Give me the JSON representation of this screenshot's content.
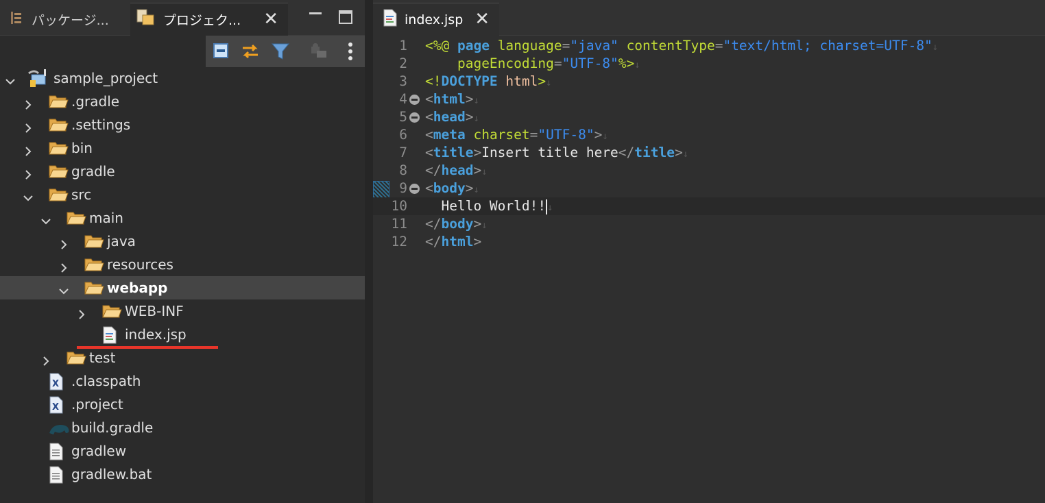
{
  "left_tabs": {
    "package_explorer": "パッケージ...",
    "project_explorer": "プロジェク..."
  },
  "tree": {
    "items": [
      {
        "label": "sample_project",
        "depth": 0,
        "expanded": true,
        "type": "project"
      },
      {
        "label": ".gradle",
        "depth": 1,
        "expanded": false,
        "type": "folder"
      },
      {
        "label": ".settings",
        "depth": 1,
        "expanded": false,
        "type": "folder"
      },
      {
        "label": "bin",
        "depth": 1,
        "expanded": false,
        "type": "folder"
      },
      {
        "label": "gradle",
        "depth": 1,
        "expanded": false,
        "type": "folder"
      },
      {
        "label": "src",
        "depth": 1,
        "expanded": true,
        "type": "folder"
      },
      {
        "label": "main",
        "depth": 2,
        "expanded": true,
        "type": "folder"
      },
      {
        "label": "java",
        "depth": 3,
        "expanded": false,
        "type": "folder"
      },
      {
        "label": "resources",
        "depth": 3,
        "expanded": false,
        "type": "folder"
      },
      {
        "label": "webapp",
        "depth": 3,
        "expanded": true,
        "type": "folder",
        "selected": true
      },
      {
        "label": "WEB-INF",
        "depth": 4,
        "expanded": false,
        "type": "folder"
      },
      {
        "label": "index.jsp",
        "depth": 4,
        "type": "jsp"
      },
      {
        "label": "test",
        "depth": 2,
        "expanded": false,
        "type": "folder"
      },
      {
        "label": ".classpath",
        "depth": 1,
        "type": "xml"
      },
      {
        "label": ".project",
        "depth": 1,
        "type": "xml"
      },
      {
        "label": "build.gradle",
        "depth": 1,
        "type": "gradle"
      },
      {
        "label": "gradlew",
        "depth": 1,
        "type": "file"
      },
      {
        "label": "gradlew.bat",
        "depth": 1,
        "type": "file"
      }
    ]
  },
  "editor": {
    "tab_label": "index.jsp",
    "current_line": 10,
    "lines": [
      {
        "n": "1",
        "fold": false,
        "tokens": [
          [
            "c-dir",
            "<%@ "
          ],
          [
            "c-kw",
            "page"
          ],
          [
            "c-text",
            " "
          ],
          [
            "c-attr",
            "language"
          ],
          [
            "c-punct",
            "="
          ],
          [
            "c-str",
            "\"java\""
          ],
          [
            "c-text",
            " "
          ],
          [
            "c-attr",
            "contentType"
          ],
          [
            "c-punct",
            "="
          ],
          [
            "c-str",
            "\"text/html; charset=UTF-8\""
          ],
          [
            "c-eol",
            "↓"
          ]
        ]
      },
      {
        "n": "2",
        "fold": false,
        "tokens": [
          [
            "c-text",
            "    "
          ],
          [
            "c-attr",
            "pageEncoding"
          ],
          [
            "c-punct",
            "="
          ],
          [
            "c-str",
            "\"UTF-8\""
          ],
          [
            "c-dir",
            "%>"
          ],
          [
            "c-eol",
            "↓"
          ]
        ]
      },
      {
        "n": "3",
        "fold": false,
        "tokens": [
          [
            "c-dir",
            "<!"
          ],
          [
            "c-kw",
            "DOCTYPE"
          ],
          [
            "c-text",
            " "
          ],
          [
            "c-doctype-name",
            "html"
          ],
          [
            "c-dir",
            ">"
          ],
          [
            "c-eol",
            "↓"
          ]
        ]
      },
      {
        "n": "4",
        "fold": true,
        "tokens": [
          [
            "c-punct",
            "<"
          ],
          [
            "c-kw",
            "html"
          ],
          [
            "c-punct",
            ">"
          ],
          [
            "c-eol",
            "↓"
          ]
        ]
      },
      {
        "n": "5",
        "fold": true,
        "tokens": [
          [
            "c-punct",
            "<"
          ],
          [
            "c-kw",
            "head"
          ],
          [
            "c-punct",
            ">"
          ],
          [
            "c-eol",
            "↓"
          ]
        ]
      },
      {
        "n": "6",
        "fold": false,
        "tokens": [
          [
            "c-punct",
            "<"
          ],
          [
            "c-kw",
            "meta"
          ],
          [
            "c-text",
            " "
          ],
          [
            "c-attr",
            "charset"
          ],
          [
            "c-punct",
            "="
          ],
          [
            "c-str",
            "\"UTF-8\""
          ],
          [
            "c-punct",
            ">"
          ],
          [
            "c-eol",
            "↓"
          ]
        ]
      },
      {
        "n": "7",
        "fold": false,
        "tokens": [
          [
            "c-punct",
            "<"
          ],
          [
            "c-kw",
            "title"
          ],
          [
            "c-punct",
            ">"
          ],
          [
            "c-text",
            "Insert title here"
          ],
          [
            "c-punct",
            "</"
          ],
          [
            "c-kw",
            "title"
          ],
          [
            "c-punct",
            ">"
          ],
          [
            "c-eol",
            "↓"
          ]
        ]
      },
      {
        "n": "8",
        "fold": false,
        "tokens": [
          [
            "c-punct",
            "</"
          ],
          [
            "c-kw",
            "head"
          ],
          [
            "c-punct",
            ">"
          ],
          [
            "c-eol",
            "↓"
          ]
        ]
      },
      {
        "n": "9",
        "fold": true,
        "tokens": [
          [
            "c-punct",
            "<"
          ],
          [
            "c-kw",
            "body"
          ],
          [
            "c-punct",
            ">"
          ],
          [
            "c-eol",
            "↓"
          ]
        ]
      },
      {
        "n": "10",
        "fold": false,
        "tokens": [
          [
            "c-text",
            "  Hello World!!"
          ],
          [
            "caret",
            ""
          ],
          [
            "c-eol",
            "↓"
          ]
        ]
      },
      {
        "n": "11",
        "fold": false,
        "tokens": [
          [
            "c-punct",
            "</"
          ],
          [
            "c-kw",
            "body"
          ],
          [
            "c-punct",
            ">"
          ],
          [
            "c-eol",
            "↓"
          ]
        ]
      },
      {
        "n": "12",
        "fold": false,
        "tokens": [
          [
            "c-punct",
            "</"
          ],
          [
            "c-kw",
            "html"
          ],
          [
            "c-punct",
            ">"
          ]
        ]
      }
    ]
  }
}
